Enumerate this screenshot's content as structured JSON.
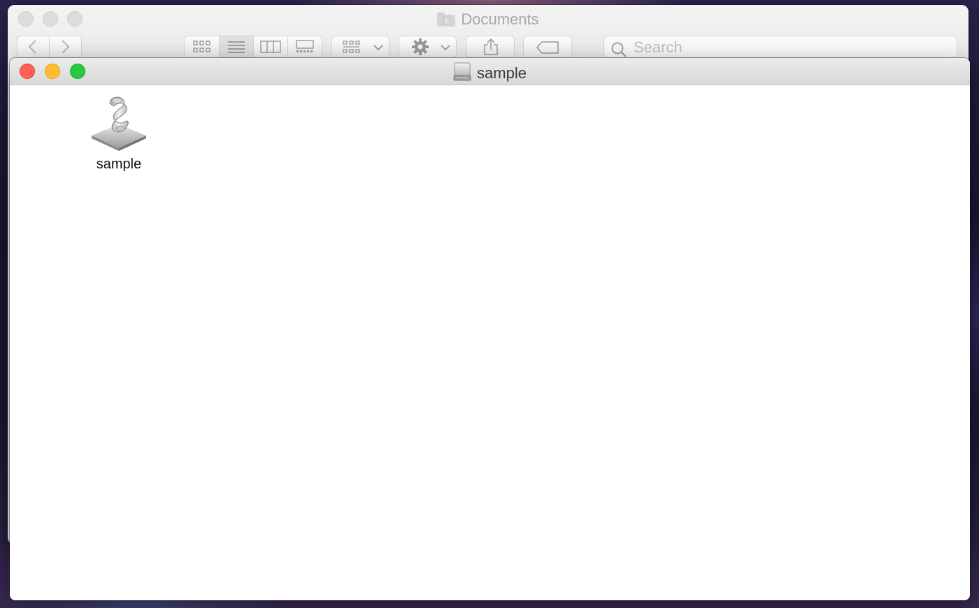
{
  "background_window": {
    "title": "Documents",
    "search": {
      "placeholder": "Search",
      "value": ""
    }
  },
  "front_window": {
    "title": "sample",
    "items": [
      {
        "name": "sample",
        "icon": "script-scroll-icon"
      }
    ]
  },
  "colors": {
    "close": "#fe5f57",
    "minimize": "#febc2e",
    "zoom": "#28c840"
  }
}
